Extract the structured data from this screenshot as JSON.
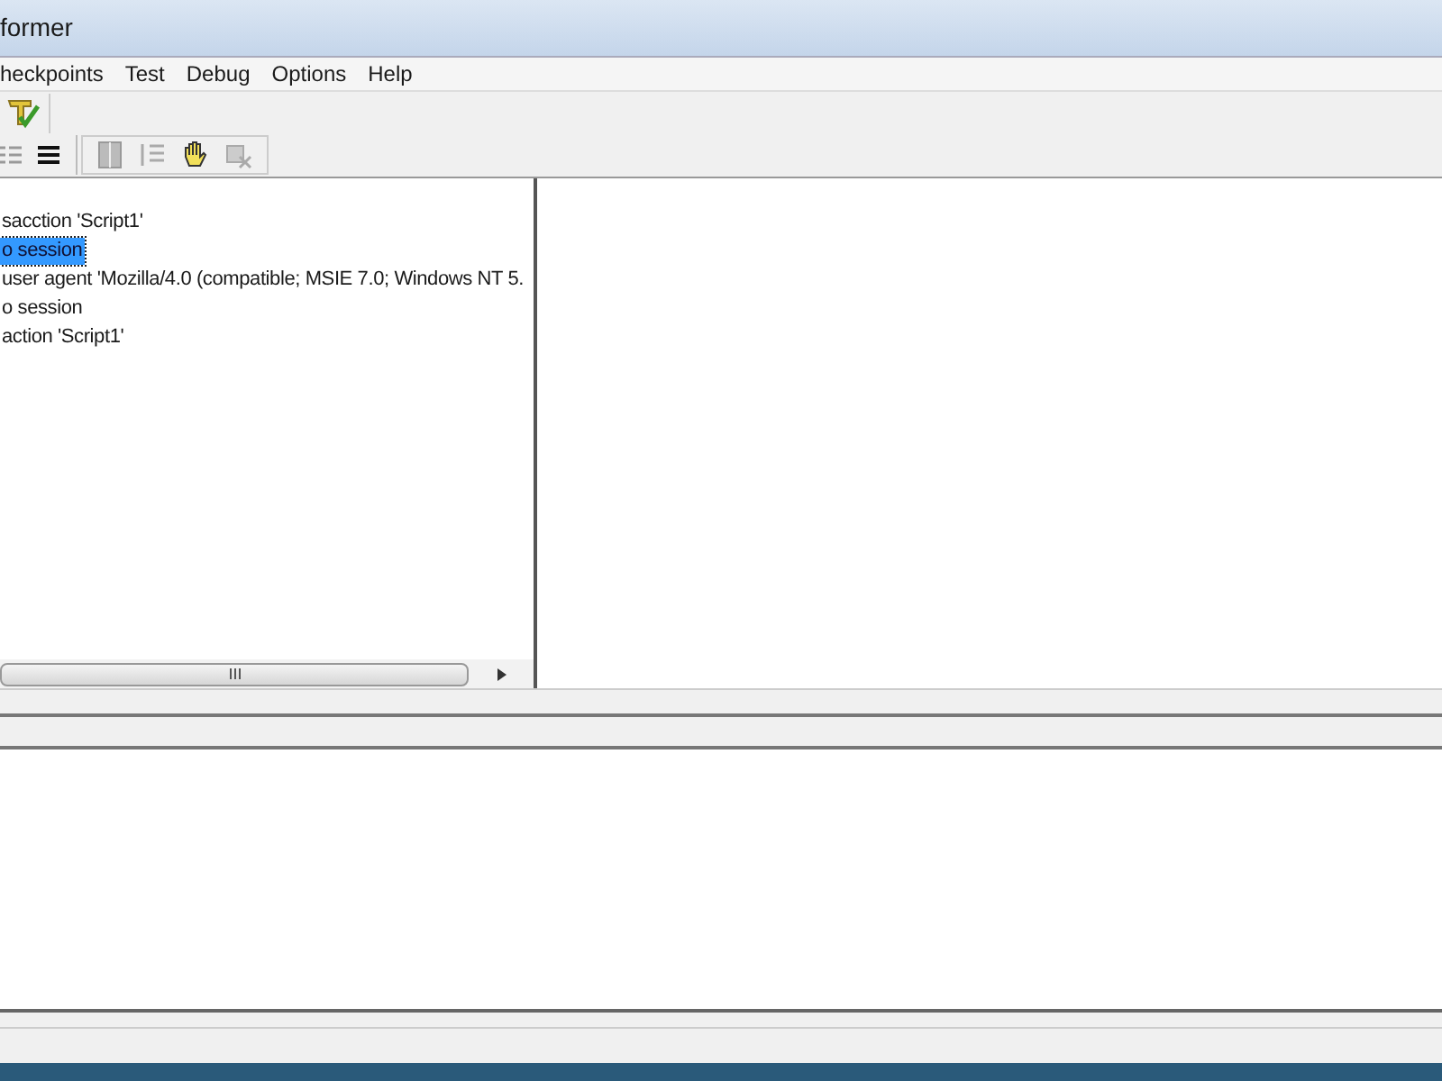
{
  "window": {
    "title": "former"
  },
  "menu": [
    {
      "label": "heckpoints"
    },
    {
      "label": "Test"
    },
    {
      "label": "Debug"
    },
    {
      "label": "Options"
    },
    {
      "label": "Help"
    }
  ],
  "tree": [
    {
      "label": "sacction 'Script1'",
      "selected": false
    },
    {
      "label": "o session",
      "selected": true
    },
    {
      "label": "user agent 'Mozilla/4.0 (compatible; MSIE 7.0; Windows NT 5.",
      "selected": false
    },
    {
      "label": "o session",
      "selected": false
    },
    {
      "label": "action 'Script1'",
      "selected": false
    }
  ]
}
